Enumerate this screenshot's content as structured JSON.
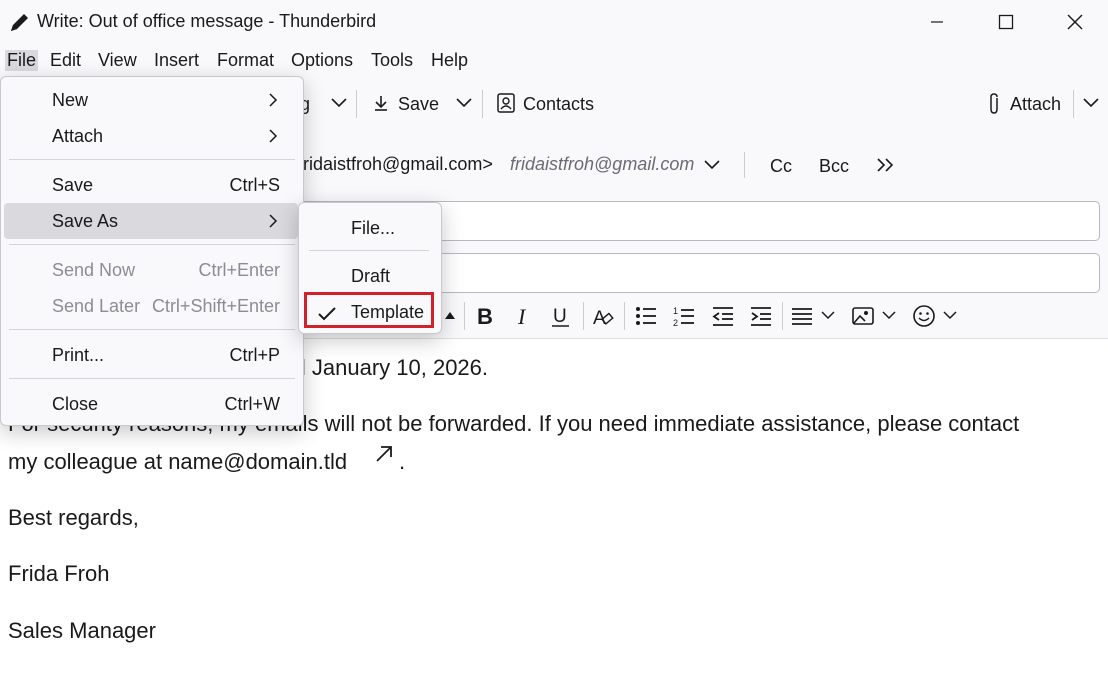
{
  "window": {
    "title": "Write: Out of office message - Thunderbird"
  },
  "menubar": {
    "items": [
      "File",
      "Edit",
      "View",
      "Insert",
      "Format",
      "Options",
      "Tools",
      "Help"
    ]
  },
  "toolbar": {
    "send_partial": "g",
    "save": "Save",
    "contacts": "Contacts",
    "attach": "Attach"
  },
  "headers": {
    "from_partial": "fridaistfroh@gmail.com>",
    "from_identity": "fridaistfroh@gmail.com",
    "cc": "Cc",
    "bcc": "Bcc"
  },
  "body": {
    "line1_partial": "il January 10, 2026.",
    "line2_partial": "For security reasons, my emails will not be forwarded. If you need immediate assistance, please contact",
    "line3": "my colleague at name@domain.tld",
    "line3_end": ".",
    "regards": "Best regards,",
    "name": "Frida Froh",
    "role": "Sales Manager"
  },
  "file_menu": {
    "new": "New",
    "attach": "Attach",
    "save": "Save",
    "save_sc": "Ctrl+S",
    "save_as": "Save As",
    "send_now": "Send Now",
    "send_now_sc": "Ctrl+Enter",
    "send_later": "Send Later",
    "send_later_sc": "Ctrl+Shift+Enter",
    "print": "Print...",
    "print_sc": "Ctrl+P",
    "close": "Close",
    "close_sc": "Ctrl+W"
  },
  "save_as_menu": {
    "file": "File...",
    "draft": "Draft",
    "template": "Template"
  },
  "colors": {
    "highlight_border": "#d0222b",
    "menu_hover": "#dadade"
  }
}
